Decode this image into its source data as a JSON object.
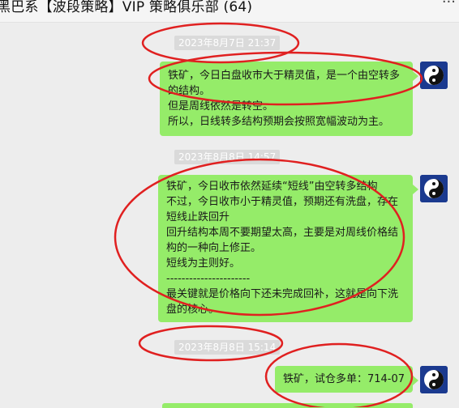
{
  "window": {
    "title": "黑巴系【波段策略】VIP 策略俱乐部 (64)",
    "more_label": "···"
  },
  "messages": [
    {
      "timestamp": "2023年8月7日 21:37",
      "lines": [
        "铁矿，今日白盘收市大于精灵值，是一个由空转多的结构。",
        "但是周线依然是转空。",
        "所以，日线转多结构预期会按照宽幅波动为主。"
      ]
    },
    {
      "timestamp": "2023年8月8日 14:57",
      "lines": [
        "铁矿，今日收市依然延续“短线”由空转多结构",
        "不过，今日收市小于精灵值，预期还有洗盘，存在短线止跌回升",
        "回升结构本周不要期望太高，主要是对周线价格结构的一种向上修正。",
        "短线为主则好。",
        "----------------------",
        "最关键就是价格向下还未完成回补，这就是向下洗盘的核心。"
      ]
    },
    {
      "timestamp": "2023年8月8日 15:14",
      "lines": [
        "铁矿，试仓多单：714-07"
      ]
    }
  ],
  "avatar": {
    "icon": "yin-yang-icon",
    "bg": "#1b3a8f"
  },
  "colors": {
    "bubble": "#95ec69",
    "annotation": "#e02020",
    "background": "#ededed"
  }
}
